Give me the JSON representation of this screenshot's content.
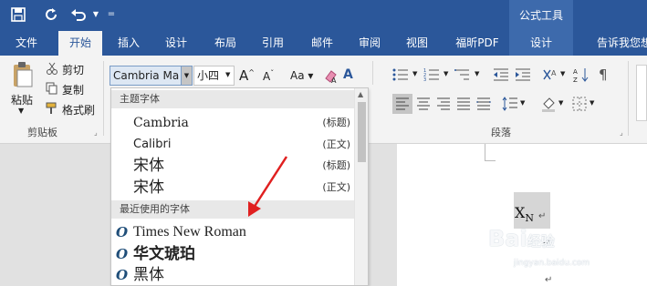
{
  "title_bar": {
    "context_group": "公式工具"
  },
  "tabs": [
    {
      "label": "文件"
    },
    {
      "label": "开始"
    },
    {
      "label": "插入"
    },
    {
      "label": "设计"
    },
    {
      "label": "布局"
    },
    {
      "label": "引用"
    },
    {
      "label": "邮件"
    },
    {
      "label": "审阅"
    },
    {
      "label": "视图"
    },
    {
      "label": "福昕PDF"
    },
    {
      "label": "设计"
    },
    {
      "label": "告诉我您想"
    }
  ],
  "clipboard": {
    "paste": "粘贴",
    "cut": "剪切",
    "copy": "复制",
    "format_painter": "格式刷",
    "group_label": "剪贴板"
  },
  "font": {
    "name_value": "Cambria Ma",
    "size_value": "小四"
  },
  "paragraph": {
    "group_label": "段落"
  },
  "dropdown": {
    "theme_header": "主题字体",
    "theme_fonts": [
      {
        "name": "Cambria",
        "sub": "(标题)"
      },
      {
        "name": "Calibri",
        "sub": "(正文)"
      },
      {
        "name": "宋体",
        "sub": "(标题)"
      },
      {
        "name": "宋体",
        "sub": "(正文)"
      }
    ],
    "recent_header": "最近使用的字体",
    "recent_fonts": [
      {
        "name": "Times New Roman"
      },
      {
        "name": "华文琥珀"
      },
      {
        "name": "黑体"
      }
    ]
  },
  "document": {
    "equation_base": "X",
    "equation_sub": "N",
    "para_mark": "↵"
  },
  "watermark": {
    "brand": "Bai",
    "brand2": "经验",
    "url": "jingyan.baidu.com"
  },
  "colors": {
    "accent": "#2b579a",
    "context_tab": "#3d6aac",
    "highlight": "#d6d6d6"
  }
}
